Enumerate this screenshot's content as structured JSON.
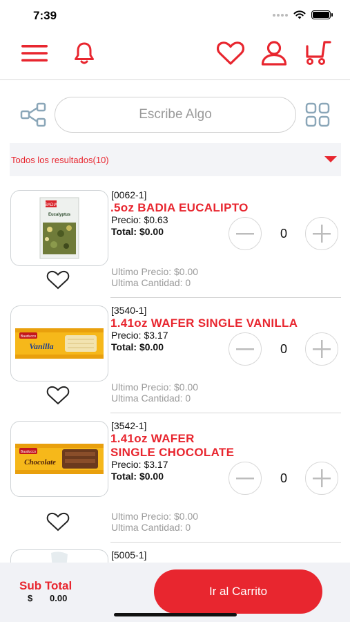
{
  "status_bar": {
    "time": "7:39"
  },
  "header": {
    "icons": [
      "menu-icon",
      "bell-icon",
      "heart-icon",
      "user-icon",
      "cart-icon"
    ],
    "accent_color": "#e8262f"
  },
  "search": {
    "placeholder": "Escribe Algo"
  },
  "filter": {
    "label": "Todos los resultados(10)"
  },
  "products": [
    {
      "code": "[0062-1]",
      "name_line1": ".5oz  BADIA EUCALIPTO",
      "name_line2": "",
      "price": "Precio: $0.63",
      "total": "Total: $0.00",
      "quantity": "0",
      "last_price": "Ultimo Precio: $0.00",
      "last_qty": "Ultima Cantidad: 0"
    },
    {
      "code": "[3540-1]",
      "name_line1": "1.41oz WAFER SINGLE VANILLA",
      "name_line2": "",
      "price": "Precio: $3.17",
      "total": "Total: $0.00",
      "quantity": "0",
      "last_price": "Ultimo Precio: $0.00",
      "last_qty": "Ultima Cantidad: 0"
    },
    {
      "code": "[3542-1]",
      "name_line1": "1.41oz WAFER",
      "name_line2": "SINGLE CHOCOLATE",
      "price": "Precio: $3.17",
      "total": "Total: $0.00",
      "quantity": "0",
      "last_price": "Ultimo Precio: $0.00",
      "last_qty": "Ultima Cantidad: 0"
    },
    {
      "code": "[5005-1]"
    }
  ],
  "footer": {
    "subtotal_label": "Sub Total",
    "currency": "$",
    "subtotal_value": "0.00",
    "cart_button": "Ir al Carrito"
  },
  "product_images": {
    "p0_label": "BADIA",
    "p0_sub": "Eucalyptus",
    "p1_brand": "Bauducco",
    "p1_flavor": "Vanilla",
    "p2_brand": "Bauducco",
    "p2_flavor": "Chocolate"
  }
}
